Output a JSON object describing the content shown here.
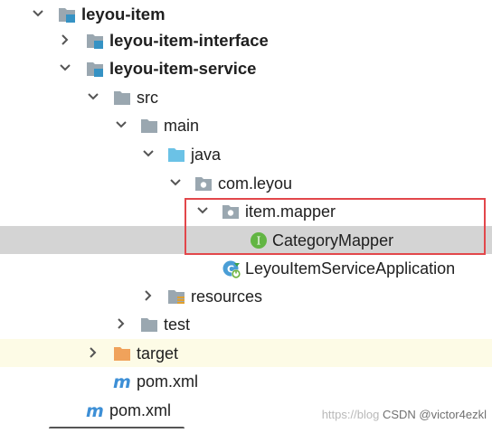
{
  "tree": {
    "nodes": [
      {
        "id": "leyou-item",
        "label": "leyou-item",
        "icon": "module-folder-icon",
        "expanded": true,
        "bold": true
      },
      {
        "id": "leyou-item-interface",
        "label": "leyou-item-interface",
        "icon": "module-folder-icon",
        "expanded": false,
        "bold": true
      },
      {
        "id": "leyou-item-service",
        "label": "leyou-item-service",
        "icon": "module-folder-icon",
        "expanded": true,
        "bold": true
      },
      {
        "id": "src",
        "label": "src",
        "icon": "folder-icon",
        "expanded": true
      },
      {
        "id": "main",
        "label": "main",
        "icon": "folder-icon",
        "expanded": true
      },
      {
        "id": "java",
        "label": "java",
        "icon": "source-root-folder-icon",
        "expanded": true
      },
      {
        "id": "com-leyou",
        "label": "com.leyou",
        "icon": "package-icon",
        "expanded": true
      },
      {
        "id": "item-mapper",
        "label": "item.mapper",
        "icon": "package-icon",
        "expanded": true
      },
      {
        "id": "category-mapper",
        "label": "CategoryMapper",
        "icon": "interface-icon",
        "selected": true
      },
      {
        "id": "leyou-item-service-application",
        "label": "LeyouItemServiceApplication",
        "icon": "spring-boot-class-icon"
      },
      {
        "id": "resources",
        "label": "resources",
        "icon": "resources-folder-icon",
        "expanded": false
      },
      {
        "id": "test",
        "label": "test",
        "icon": "folder-icon",
        "expanded": false
      },
      {
        "id": "target",
        "label": "target",
        "icon": "excluded-folder-icon",
        "expanded": false
      },
      {
        "id": "pom-service",
        "label": "pom.xml",
        "icon": "maven-icon"
      },
      {
        "id": "pom-item",
        "label": "pom.xml",
        "icon": "maven-icon"
      }
    ]
  },
  "watermark": {
    "faded": "https://blog",
    "text": "CSDN @victor4ezkl"
  },
  "colors": {
    "selection": "#d4d4d4",
    "excluded_row": "#fdfbe6",
    "highlight_border": "#e2474b",
    "folder": "#9aa7b0",
    "source_folder": "#6bc2e6",
    "excluded_folder": "#f0a25b",
    "interface_badge": "#62b543",
    "maven": "#3d8fd6"
  }
}
